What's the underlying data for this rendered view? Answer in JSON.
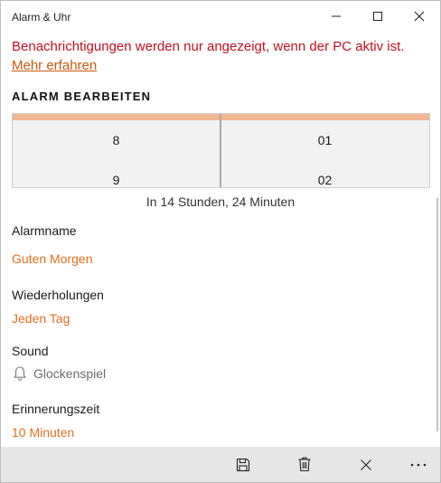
{
  "window": {
    "title": "Alarm & Uhr",
    "controls": [
      "minimize-icon",
      "maximize-icon",
      "close-icon"
    ]
  },
  "notice": {
    "text": "Benachrichtigungen werden nur angezeigt, wenn der PC aktiv ist.",
    "link": "Mehr erfahren"
  },
  "section": {
    "heading": "ALARM BEARBEITEN"
  },
  "time_picker": {
    "hours": [
      "8",
      "9"
    ],
    "minutes": [
      "01",
      "02"
    ]
  },
  "until": "In 14 Stunden, 24 Minuten",
  "alarm_name": {
    "label": "Alarmname",
    "value": "Guten Morgen"
  },
  "repeat": {
    "label": "Wiederholungen",
    "value": "Jeden Tag"
  },
  "sound": {
    "label": "Sound",
    "value": "Glockenspiel",
    "icon": "bell-icon"
  },
  "snooze": {
    "label": "Erinnerungszeit",
    "value": "10 Minuten"
  },
  "app_bar": {
    "buttons": [
      "save-icon",
      "delete-icon",
      "close-icon",
      "more-icon"
    ]
  },
  "colors": {
    "accent": "#e3701c",
    "picker_accent": "#f0b592",
    "warning": "#c50f1f",
    "link": "#c75a0a",
    "app_bar_bg": "#e6e6e6"
  }
}
